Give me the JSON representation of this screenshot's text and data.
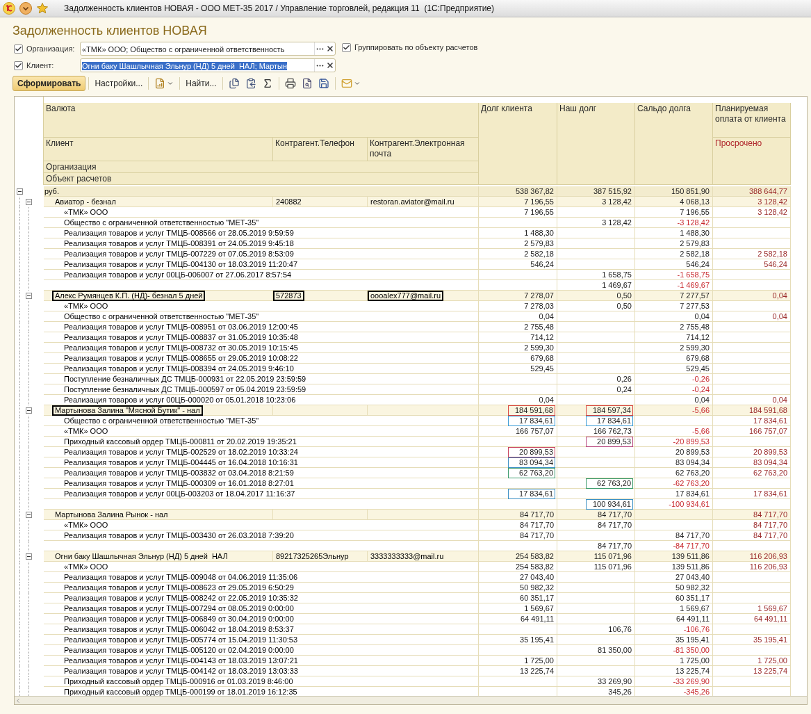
{
  "window": {
    "title": "Задолженность клиентов НОВАЯ - ООО МЕТ-35 2017 / Управление торговлей, редакция 11  (1С:Предприятие)"
  },
  "report": {
    "title": "Задолженность клиентов НОВАЯ"
  },
  "filters": [
    {
      "label": "Организация:",
      "checked": true,
      "value": "«ТМК» ООО; Общество с ограниченной ответственность",
      "selected": false
    },
    {
      "label": "Клиент:",
      "checked": true,
      "value": "Огни баку Шашлычная Эльнур (НД) 5 дней  НАЛ; Мартын",
      "selected": true
    }
  ],
  "group_by_object": {
    "label": "Группировать по объекту расчетов",
    "checked": true
  },
  "toolbar": {
    "generate": "Сформировать",
    "settings": "Настройки...",
    "find": "Найти..."
  },
  "table": {
    "headers": {
      "currency": "Валюта",
      "client": "Клиент",
      "phone": "Контрагент.Телефон",
      "email": "Контрагент.Электронная почта",
      "organization": "Организация",
      "settlement_object": "Объект расчетов",
      "client_debt": "Долг клиента",
      "our_debt": "Наш долг",
      "balance": "Сальдо долга",
      "planned": "Планируемая оплата от клиента",
      "overdue": "Просрочено"
    },
    "currency": {
      "label": "руб.",
      "expanded": true,
      "client_debt": "538 367,82",
      "our_debt": "387 515,92",
      "balance": "150 851,90",
      "planned": "388 644,77",
      "children": [
        {
          "name": "Авиатор - безнал",
          "phone": "240882",
          "email": "restoran.aviator@mail.ru",
          "expanded": true,
          "name_outlined": false,
          "phone_outlined": false,
          "email_outlined": false,
          "client_debt": "7 196,55",
          "our_debt": "3 128,42",
          "balance": "4 068,13",
          "planned": "3 128,42",
          "children": [
            {
              "label": "«ТМК» ООО",
              "client_debt": "7 196,55",
              "balance": "7 196,55",
              "planned": "3 128,42"
            },
            {
              "label": "Общество с ограниченной ответственностью \"МЕТ-35\"",
              "our_debt": "3 128,42",
              "balance": "-3 128,42",
              "negative": true
            },
            {
              "label": "Реализация товаров и услуг ТМЦБ-008566 от 28.05.2019 9:59:59",
              "client_debt": "1 488,30",
              "balance": "1 488,30"
            },
            {
              "label": "Реализация товаров и услуг ТМЦБ-008391 от 24.05.2019 9:45:18",
              "client_debt": "2 579,83",
              "balance": "2 579,83"
            },
            {
              "label": "Реализация товаров и услуг ТМЦБ-007229 от 07.05.2019 8:53:09",
              "client_debt": "2 582,18",
              "balance": "2 582,18",
              "planned": "2 582,18"
            },
            {
              "label": "Реализация товаров и услуг ТМЦБ-004130 от 18.03.2019 11:20:47",
              "client_debt": "546,24",
              "balance": "546,24",
              "planned": "546,24"
            },
            {
              "label": "Реализация товаров и услуг 00ЦБ-006007 от 27.06.2017 8:57:54",
              "our_debt": "1 658,75",
              "balance": "-1 658,75",
              "negative": true
            },
            {
              "our_debt": "1 469,67",
              "balance": "-1 469,67",
              "negative": true
            }
          ]
        },
        {
          "name": "Алекс Румянцев К.П. (НД)- безнал 5 дней",
          "phone": "572873",
          "email": "oooalex777@mail.ru",
          "expanded": true,
          "name_outlined": true,
          "phone_outlined": true,
          "email_outlined": true,
          "client_debt": "7 278,07",
          "our_debt": "0,50",
          "balance": "7 277,57",
          "planned": "0,04",
          "children": [
            {
              "label": "«ТМК» ООО",
              "client_debt": "7 278,03",
              "our_debt": "0,50",
              "balance": "7 277,53"
            },
            {
              "label": "Общество с ограниченной ответственностью \"МЕТ-35\"",
              "client_debt": "0,04",
              "balance": "0,04",
              "planned": "0,04"
            },
            {
              "label": "Реализация товаров и услуг ТМЦБ-008951 от 03.06.2019 12:00:45",
              "client_debt": "2 755,48",
              "balance": "2 755,48"
            },
            {
              "label": "Реализация товаров и услуг ТМЦБ-008837 от 31.05.2019 10:35:48",
              "client_debt": "714,12",
              "balance": "714,12"
            },
            {
              "label": "Реализация товаров и услуг ТМЦБ-008732 от 30.05.2019 10:15:45",
              "client_debt": "2 599,30",
              "balance": "2 599,30"
            },
            {
              "label": "Реализация товаров и услуг ТМЦБ-008655 от 29.05.2019 10:08:22",
              "client_debt": "679,68",
              "balance": "679,68"
            },
            {
              "label": "Реализация товаров и услуг ТМЦБ-008394 от 24.05.2019 9:46:10",
              "client_debt": "529,45",
              "balance": "529,45"
            },
            {
              "label": "Поступление безналичных ДС ТМЦБ-000931 от 22.05.2019 23:59:59",
              "our_debt": "0,26",
              "balance": "-0,26",
              "negative": true
            },
            {
              "label": "Поступление безналичных ДС ТМЦБ-000597 от 05.04.2019 23:59:59",
              "our_debt": "0,24",
              "balance": "-0,24",
              "negative": true
            },
            {
              "label": "Реализация товаров и услуг 00ЦБ-000020 от 05.01.2018 10:23:06",
              "client_debt": "0,04",
              "balance": "0,04",
              "planned": "0,04"
            }
          ]
        },
        {
          "name": "Мартынова Залина \"Мясной Бутик\" - нал",
          "expanded": true,
          "name_outlined": true,
          "client_debt": "184 591,68",
          "our_debt": "184 597,34",
          "balance": "-5,66",
          "negative": true,
          "planned": "184 591,68",
          "framed": {
            "client_debt": {
              "color": "#d9443f"
            },
            "our_debt": {
              "color": "#d9443f"
            }
          },
          "children": [
            {
              "label": "Общество с ограниченной ответственностью \"МЕТ-35\"",
              "client_debt": "17 834,61",
              "our_debt": "17 834,61",
              "planned": "17 834,61",
              "framed": {
                "client_debt": {
                  "color": "#3a9bd5"
                },
                "our_debt": {
                  "color": "#3a9bd5"
                }
              }
            },
            {
              "label": "«ТМК» ООО",
              "client_debt": "166 757,07",
              "our_debt": "166 762,73",
              "balance": "-5,66",
              "negative": true,
              "planned": "166 757,07"
            },
            {
              "label": "Приходный кассовый ордер ТМЦБ-000811 от 20.02.2019 19:35:21",
              "our_debt": "20 899,53",
              "balance": "-20 899,53",
              "negative": true,
              "framed": {
                "our_debt": {
                  "color": "#b8487f"
                }
              }
            },
            {
              "label": "Реализация товаров и услуг ТМЦБ-002529 от 18.02.2019 10:33:24",
              "client_debt": "20 899,53",
              "balance": "20 899,53",
              "planned": "20 899,53",
              "framed": {
                "client_debt": {
                  "color": "#c8405c"
                }
              }
            },
            {
              "label": "Реализация товаров и услуг ТМЦБ-004445 от 16.04.2018 10:16:31",
              "client_debt": "83 094,34",
              "balance": "83 094,34",
              "planned": "83 094,34",
              "framed": {
                "client_debt": {
                  "color": "#3a8fc4"
                }
              }
            },
            {
              "label": "Реализация товаров и услуг ТМЦБ-003832 от 03.04.2018 8:21:59",
              "client_debt": "62 763,20",
              "balance": "62 763,20",
              "planned": "62 763,20",
              "framed": {
                "client_debt": {
                  "color": "#3a9a6a"
                }
              }
            },
            {
              "label": "Реализация товаров и услуг ТМЦБ-000309 от 16.01.2018 8:27:01",
              "our_debt": "62 763,20",
              "balance": "-62 763,20",
              "negative": true,
              "framed": {
                "our_debt": {
                  "color": "#3a9a6a"
                }
              }
            },
            {
              "label": "Реализация товаров и услуг 00ЦБ-003203 от 18.04.2017 11:16:37",
              "client_debt": "17 834,61",
              "balance": "17 834,61",
              "planned": "17 834,61",
              "framed": {
                "client_debt": {
                  "color": "#3a8fc4"
                }
              }
            },
            {
              "our_debt": "100 934,61",
              "balance": "-100 934,61",
              "negative": true,
              "framed": {
                "our_debt": {
                  "color": "#3a8fc4"
                }
              }
            }
          ]
        },
        {
          "name": "Мартынова Залина Рынок - нал",
          "expanded": true,
          "name_outlined": false,
          "client_debt": "84 717,70",
          "our_debt": "84 717,70",
          "planned": "84 717,70",
          "children": [
            {
              "label": "«ТМК» ООО",
              "client_debt": "84 717,70",
              "our_debt": "84 717,70",
              "planned": "84 717,70"
            },
            {
              "label": "Реализация товаров и услуг ТМЦБ-003430 от 26.03.2018 7:39:20",
              "client_debt": "84 717,70",
              "balance": "84 717,70",
              "planned": "84 717,70"
            },
            {
              "our_debt": "84 717,70",
              "balance": "-84 717,70",
              "negative": true
            }
          ]
        },
        {
          "name": "Огни баку Шашлычная Эльнур (НД) 5 дней  НАЛ",
          "phone": "89217325265Эльнур",
          "email": "3333333333@mail.ru",
          "expanded": true,
          "name_outlined": false,
          "phone_outlined": false,
          "email_outlined": false,
          "client_debt": "254 583,82",
          "our_debt": "115 071,96",
          "balance": "139 511,86",
          "planned": "116 206,93",
          "children": [
            {
              "label": "«ТМК» ООО",
              "client_debt": "254 583,82",
              "our_debt": "115 071,96",
              "balance": "139 511,86",
              "planned": "116 206,93"
            },
            {
              "label": "Реализация товаров и услуг ТМЦБ-009048 от 04.06.2019 11:35:06",
              "client_debt": "27 043,40",
              "balance": "27 043,40"
            },
            {
              "label": "Реализация товаров и услуг ТМЦБ-008623 от 29.05.2019 6:50:29",
              "client_debt": "50 982,32",
              "balance": "50 982,32"
            },
            {
              "label": "Реализация товаров и услуг ТМЦБ-008242 от 22.05.2019 10:35:32",
              "client_debt": "60 351,17",
              "balance": "60 351,17"
            },
            {
              "label": "Реализация товаров и услуг ТМЦБ-007294 от 08.05.2019 0:00:00",
              "client_debt": "1 569,67",
              "balance": "1 569,67",
              "planned": "1 569,67"
            },
            {
              "label": "Реализация товаров и услуг ТМЦБ-006849 от 30.04.2019 0:00:00",
              "client_debt": "64 491,11",
              "balance": "64 491,11",
              "planned": "64 491,11"
            },
            {
              "label": "Реализация товаров и услуг ТМЦБ-006042 от 18.04.2019 8:53:37",
              "our_debt": "106,76",
              "balance": "-106,76",
              "negative": true
            },
            {
              "label": "Реализация товаров и услуг ТМЦБ-005774 от 15.04.2019 11:30:53",
              "client_debt": "35 195,41",
              "balance": "35 195,41",
              "planned": "35 195,41"
            },
            {
              "label": "Реализация товаров и услуг ТМЦБ-005120 от 02.04.2019 0:00:00",
              "our_debt": "81 350,00",
              "balance": "-81 350,00",
              "negative": true
            },
            {
              "label": "Реализация товаров и услуг ТМЦБ-004143 от 18.03.2019 13:07:21",
              "client_debt": "1 725,00",
              "balance": "1 725,00",
              "planned": "1 725,00"
            },
            {
              "label": "Реализация товаров и услуг ТМЦБ-004142 от 18.03.2019 13:03:33",
              "client_debt": "13 225,74",
              "balance": "13 225,74",
              "planned": "13 225,74"
            },
            {
              "label": "Приходный кассовый ордер ТМЦБ-000916 от 01.03.2019 8:46:00",
              "our_debt": "33 269,90",
              "balance": "-33 269,90",
              "negative": true
            },
            {
              "label": "Приходный кассовый ордер ТМЦБ-000199 от 18.01.2019 16:12:35",
              "our_debt": "345,26",
              "balance": "-345,26",
              "negative": true
            }
          ]
        }
      ]
    }
  }
}
